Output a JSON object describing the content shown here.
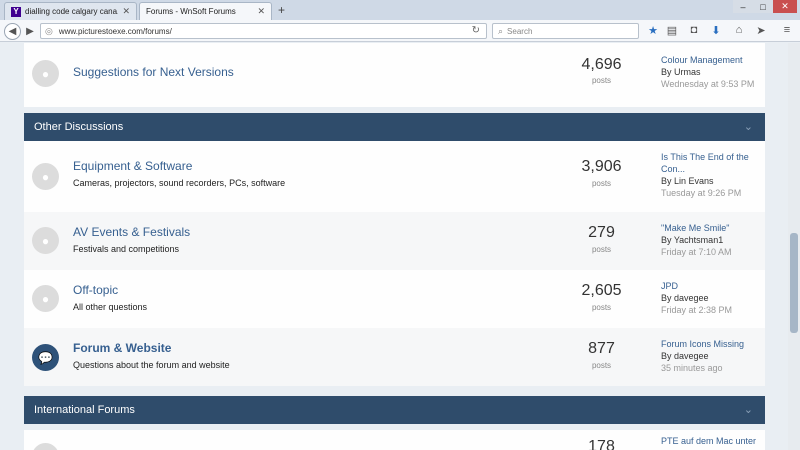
{
  "browser": {
    "tabs": [
      {
        "label": "dialling code calgary cana...",
        "favicon": "Y"
      },
      {
        "label": "Forums - WnSoft Forums"
      }
    ],
    "url": "www.picturestoexe.com/forums/",
    "search_placeholder": "Search"
  },
  "top_row": {
    "title": "Suggestions for Next Versions",
    "count": "4,696",
    "count_label": "posts",
    "last_post": {
      "title": "Colour Management",
      "by": "By Urmas",
      "date": "Wednesday at 9:53 PM"
    }
  },
  "categories": [
    {
      "title": "Other Discussions"
    },
    {
      "title": "International Forums"
    }
  ],
  "forums": [
    {
      "title": "Equipment & Software",
      "desc": "Cameras, projectors, sound recorders, PCs, software",
      "count": "3,906",
      "count_label": "posts",
      "last_post": {
        "title": "Is This The End of the Con...",
        "by": "By Lin Evans",
        "date": "Tuesday at 9:26 PM"
      }
    },
    {
      "title": "AV Events & Festivals",
      "desc": "Festivals and competitions",
      "count": "279",
      "count_label": "posts",
      "last_post": {
        "title": "\"Make Me Smile\"",
        "by": "By Yachtsman1",
        "date": "Friday at 7:10 AM"
      }
    },
    {
      "title": "Off-topic",
      "desc": "All other questions",
      "count": "2,605",
      "count_label": "posts",
      "last_post": {
        "title": "JPD",
        "by": "By davegee",
        "date": "Friday at 2:38 PM"
      }
    },
    {
      "title": "Forum & Website",
      "desc": "Questions about the forum and website",
      "count": "877",
      "count_label": "posts",
      "last_post": {
        "title": "Forum Icons Missing",
        "by": "By davegee",
        "date": "35 minutes ago"
      }
    }
  ],
  "bottom_row": {
    "count": "178",
    "last_post_title": "PTE auf dem Mac unter"
  },
  "colors": {
    "category_header": "#2f4c6b",
    "link": "#376090",
    "unread_icon": "#2e5279"
  }
}
